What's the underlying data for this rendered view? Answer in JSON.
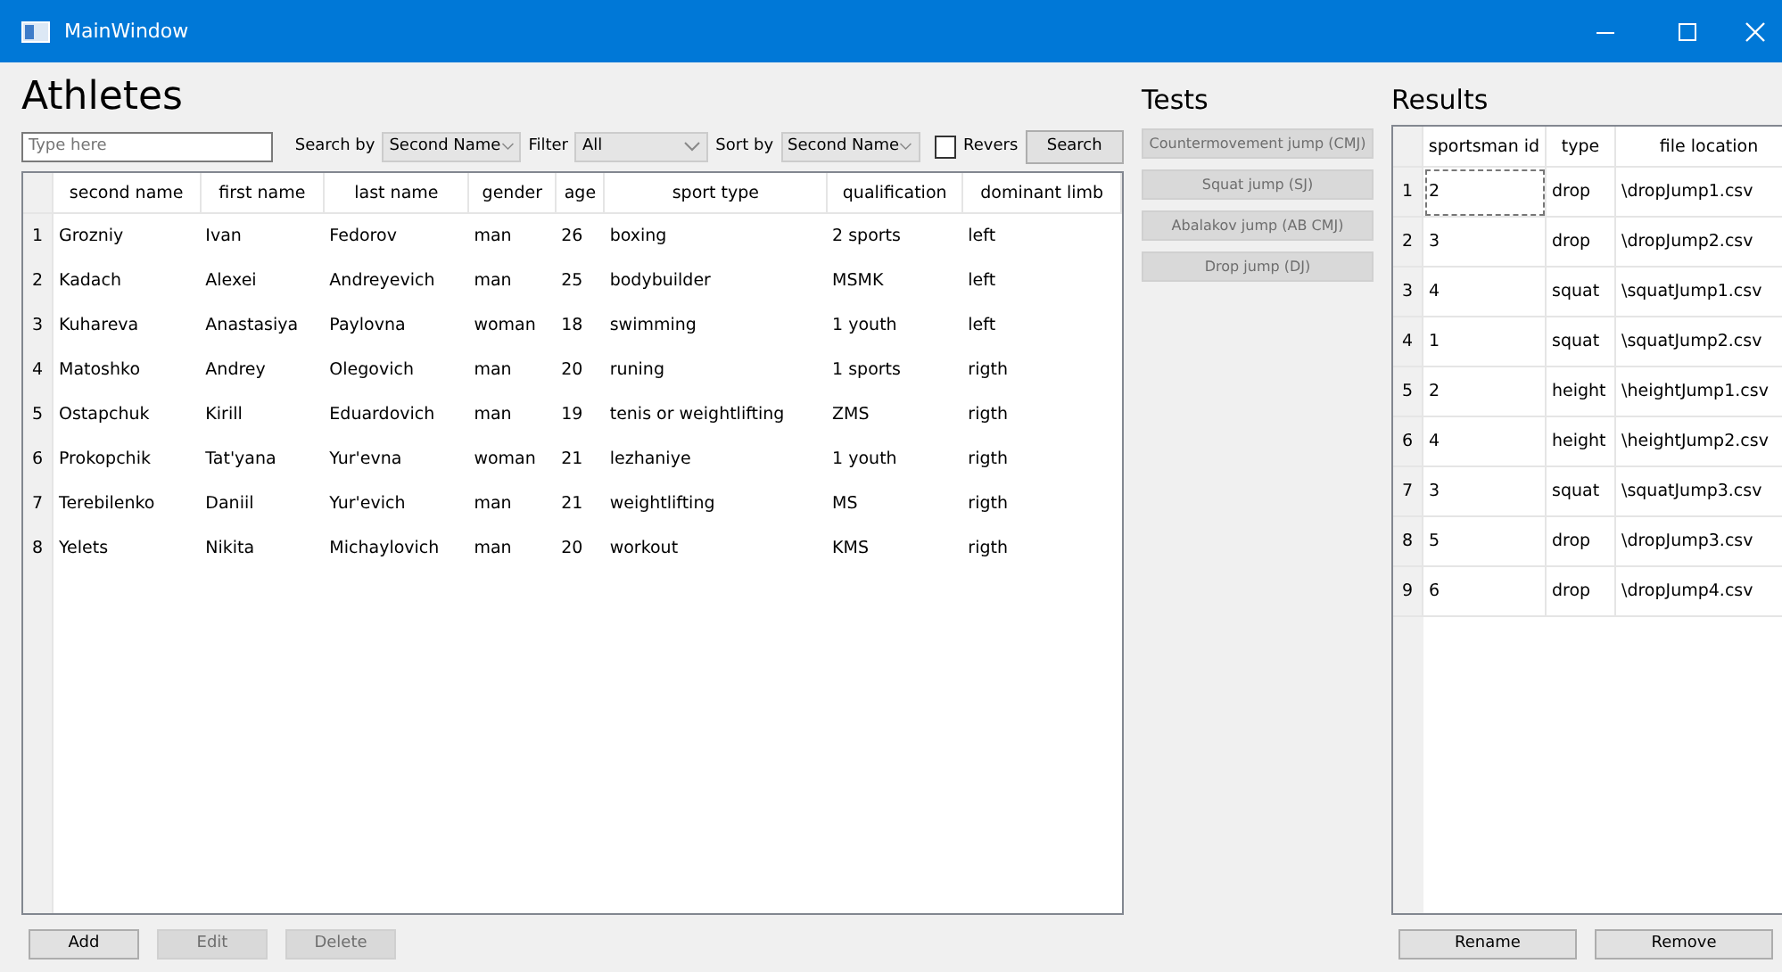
{
  "window": {
    "title": "MainWindow"
  },
  "athletes": {
    "heading": "Athletes",
    "search": {
      "placeholder": "Type here"
    },
    "search_by": {
      "label": "Search by",
      "value": "Second Name"
    },
    "filter": {
      "label": "Filter",
      "value": "All"
    },
    "sort_by": {
      "label": "Sort by",
      "value": "Second Name"
    },
    "revers": {
      "label": "Revers",
      "checked": false
    },
    "search_button": {
      "label": "Search",
      "disabled": false
    },
    "table": {
      "columns": [
        "second name",
        "first name",
        "last name",
        "gender",
        "age",
        "sport type",
        "qualification",
        "dominant limb"
      ],
      "rows": [
        {
          "number": "1",
          "cells": [
            "Grozniy",
            "Ivan",
            "Fedorov",
            "man",
            "26",
            "boxing",
            "2 sports",
            "left"
          ]
        },
        {
          "number": "2",
          "cells": [
            "Kadach",
            "Alexei",
            "Andreyevich",
            "man",
            "25",
            "bodybuilder",
            "MSMK",
            "left"
          ]
        },
        {
          "number": "3",
          "cells": [
            "Kuhareva",
            "Anastasiya",
            "Paylovna",
            "woman",
            "18",
            "swimming",
            "1 youth",
            "left"
          ]
        },
        {
          "number": "4",
          "cells": [
            "Matoshko",
            "Andrey",
            "Olegovich",
            "man",
            "20",
            "runing",
            "1 sports",
            "rigth"
          ]
        },
        {
          "number": "5",
          "cells": [
            "Ostapchuk",
            "Kirill",
            "Eduardovich",
            "man",
            "19",
            "tenis or weightlifting",
            "ZMS",
            "rigth"
          ]
        },
        {
          "number": "6",
          "cells": [
            "Prokopchik",
            "Tat'yana",
            "Yur'evna",
            "woman",
            "21",
            "lezhaniye",
            "1 youth",
            "rigth"
          ]
        },
        {
          "number": "7",
          "cells": [
            "Terebilenko",
            "Daniil",
            "Yur'evich",
            "man",
            "21",
            "weightlifting",
            "MS",
            "rigth"
          ]
        },
        {
          "number": "8",
          "cells": [
            "Yelets",
            "Nikita",
            "Michaylovich",
            "man",
            "20",
            "workout",
            "KMS",
            "rigth"
          ]
        }
      ]
    },
    "buttons": [
      {
        "label": "Add",
        "disabled": false
      },
      {
        "label": "Edit",
        "disabled": true
      },
      {
        "label": "Delete",
        "disabled": true
      }
    ]
  },
  "tests": {
    "heading": "Tests",
    "buttons": [
      {
        "label": "Countermovement jump (CMJ)",
        "disabled": true
      },
      {
        "label": "Squat jump (SJ)",
        "disabled": true
      },
      {
        "label": "Abalakov jump (AB CMJ)",
        "disabled": true
      },
      {
        "label": "Drop jump (DJ)",
        "disabled": true
      }
    ]
  },
  "results": {
    "heading": "Results",
    "table": {
      "columns": [
        "sportsman id",
        "type",
        "file location"
      ],
      "rows": [
        {
          "number": "1",
          "cells": [
            "2",
            "drop",
            "\\dropJump1.csv"
          ],
          "focused": true
        },
        {
          "number": "2",
          "cells": [
            "3",
            "drop",
            "\\dropJump2.csv"
          ],
          "focused": false
        },
        {
          "number": "3",
          "cells": [
            "4",
            "squat",
            "\\squatJump1.csv"
          ],
          "focused": false
        },
        {
          "number": "4",
          "cells": [
            "1",
            "squat",
            "\\squatJump2.csv"
          ],
          "focused": false
        },
        {
          "number": "5",
          "cells": [
            "2",
            "height",
            "\\heightJump1.csv"
          ],
          "focused": false
        },
        {
          "number": "6",
          "cells": [
            "4",
            "height",
            "\\heightJump2.csv"
          ],
          "focused": false
        },
        {
          "number": "7",
          "cells": [
            "3",
            "squat",
            "\\squatJump3.csv"
          ],
          "focused": false
        },
        {
          "number": "8",
          "cells": [
            "5",
            "drop",
            "\\dropJump3.csv"
          ],
          "focused": false
        },
        {
          "number": "9",
          "cells": [
            "6",
            "drop",
            "\\dropJump4.csv"
          ],
          "focused": false
        }
      ]
    },
    "buttons": [
      {
        "label": "Rename",
        "disabled": false
      },
      {
        "label": "Remove",
        "disabled": false
      }
    ]
  }
}
